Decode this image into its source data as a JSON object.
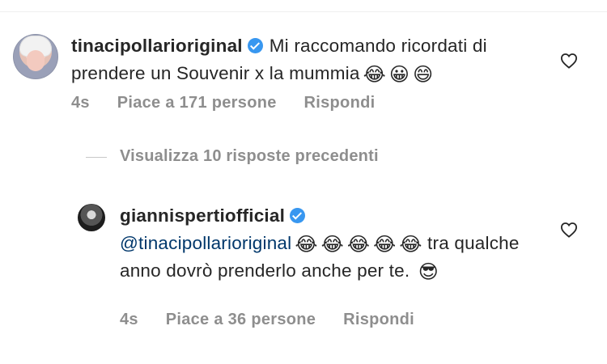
{
  "comment": {
    "username": "tinacipollarioriginal",
    "text": "Mi raccomando ricordati di prendere un  Souvenir x la mummia",
    "emojis": [
      "😂",
      "😀",
      "😄"
    ],
    "time": "4s",
    "likes": "Piace a 171 persone",
    "reply_label": "Rispondi"
  },
  "view_replies": "Visualizza 10 risposte precedenti",
  "reply": {
    "username": "giannispertiofficial",
    "mention": "@tinacipollarioriginal",
    "emojis": [
      "😂",
      "😂",
      "😂",
      "😂",
      "😂"
    ],
    "text": "tra qualche anno dovrò prenderlo anche per te.",
    "end_emoji": "😎",
    "time": "4s",
    "likes": "Piace a 36 persone",
    "reply_label": "Rispondi"
  },
  "colors": {
    "verified": "#3897f0",
    "meta": "#8e8e8e",
    "mention": "#00376b"
  }
}
